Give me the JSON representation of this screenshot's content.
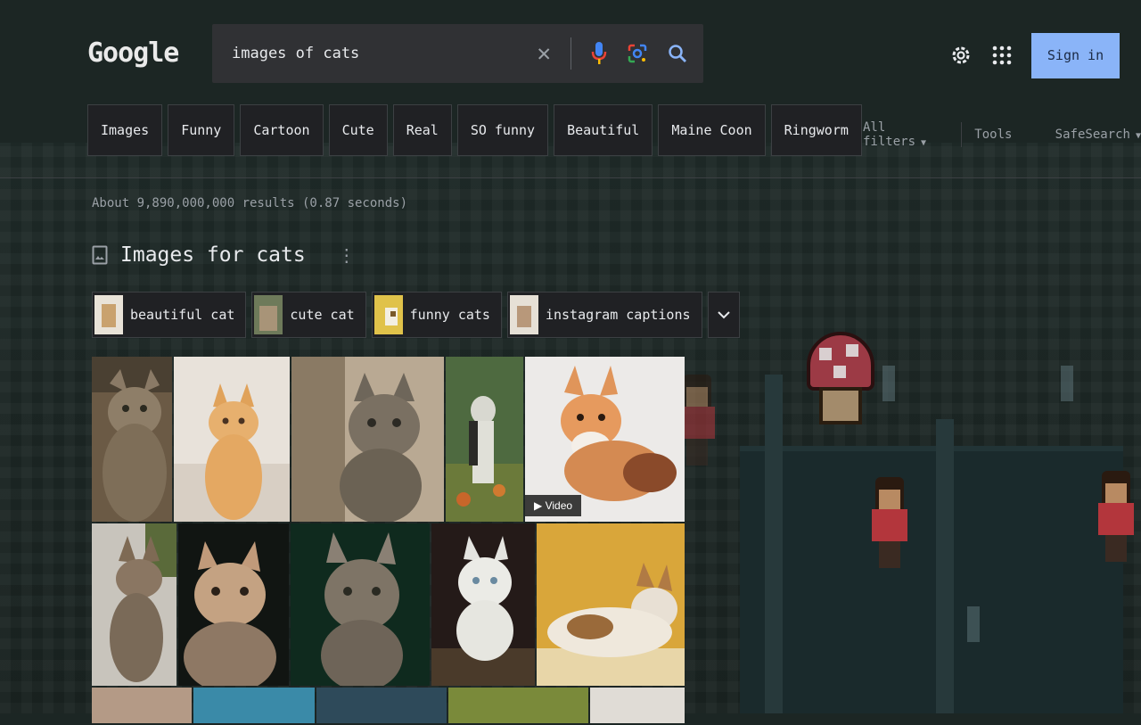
{
  "header": {
    "logo": "Google",
    "search_value": "images of cats",
    "signin_label": "Sign in"
  },
  "chips": [
    "Images",
    "Funny",
    "Cartoon",
    "Cute",
    "Real",
    "SO funny",
    "Beautiful",
    "Maine Coon",
    "Ringworm"
  ],
  "toolbar": {
    "all_filters": "All filters",
    "tools": "Tools",
    "safesearch": "SafeSearch"
  },
  "results": {
    "stats": "About 9,890,000,000 results (0.87 seconds)",
    "images_heading": "Images for cats"
  },
  "related": [
    {
      "label": "beautiful cat",
      "thumb": "#c9a26e"
    },
    {
      "label": "cute cat",
      "thumb": "#8c7a62"
    },
    {
      "label": "funny cats",
      "thumb": "#e0c24a"
    },
    {
      "label": "instagram captions",
      "thumb": "#b8987a"
    }
  ],
  "images": {
    "video_badge": "Video",
    "colors": {
      "bg_dark": "#1c2624",
      "chip_bg": "#202124",
      "accent": "#8ab4f8",
      "search_bg": "#303134"
    }
  }
}
